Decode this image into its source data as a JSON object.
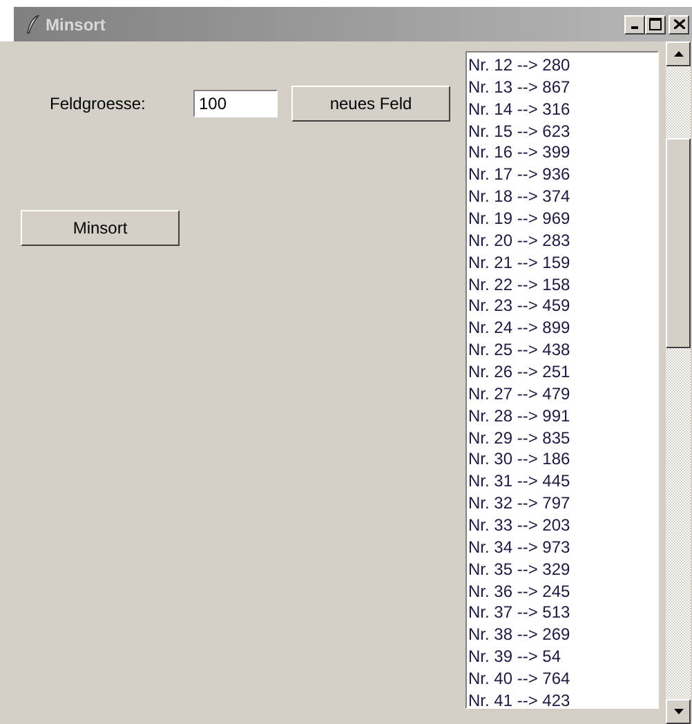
{
  "window": {
    "title": "Minsort"
  },
  "size_label": "Feldgroesse:",
  "size_field": {
    "value": "100"
  },
  "buttons": [
    {
      "label": "neues Feld"
    },
    {
      "label": "Minsort"
    }
  ],
  "list": [
    "Nr. 12 --> 280",
    "Nr. 13 --> 867",
    "Nr. 14 --> 316",
    "Nr. 15 --> 623",
    "Nr. 16 --> 399",
    "Nr. 17 --> 936",
    "Nr. 18 --> 374",
    "Nr. 19 --> 969",
    "Nr. 20 --> 283",
    "Nr. 21 --> 159",
    "Nr. 22 --> 158",
    "Nr. 23 --> 459",
    "Nr. 24 --> 899",
    "Nr. 25 --> 438",
    "Nr. 26 --> 251",
    "Nr. 27 --> 479",
    "Nr. 28 --> 991",
    "Nr. 29 --> 835",
    "Nr. 30 --> 186",
    "Nr. 31 --> 445",
    "Nr. 32 --> 797",
    "Nr. 33 --> 203",
    "Nr. 34 --> 973",
    "Nr. 35 --> 329",
    "Nr. 36 --> 245",
    "Nr. 37 --> 513",
    "Nr. 38 --> 269",
    "Nr. 39 --> 54",
    "Nr. 40 --> 764",
    "Nr. 41 --> 423"
  ]
}
